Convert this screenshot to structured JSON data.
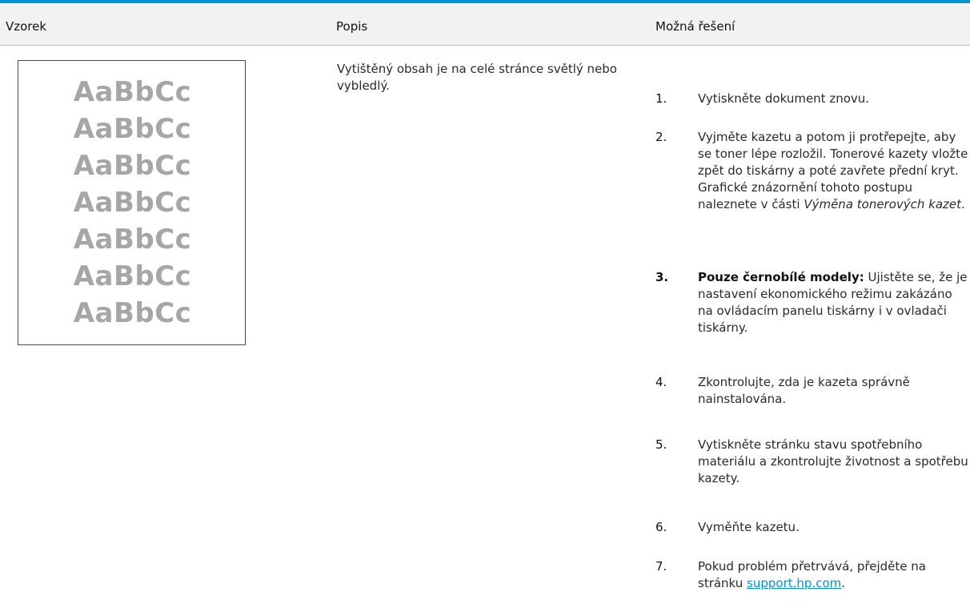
{
  "colors": {
    "top_rule": "#0096d6",
    "header_bg": "#f2f2f2",
    "sample_text": "#a6a6a6",
    "link": "#0096d6"
  },
  "table": {
    "headers": {
      "sample": "Vzorek",
      "description": "Popis",
      "solutions": "Možná řešení"
    }
  },
  "sample": {
    "lines": [
      "AaBbCc",
      "AaBbCc",
      "AaBbCc",
      "AaBbCc",
      "AaBbCc",
      "AaBbCc",
      "AaBbCc"
    ]
  },
  "description": "Vytištěný obsah je na celé stránce světlý nebo vybledlý.",
  "steps": [
    {
      "num": "1.",
      "text": "Vytiskněte dokument znovu."
    },
    {
      "num": "2.",
      "text": "Vyjměte kazetu a potom ji protřepejte, aby se toner lépe rozložil. Tonerové kazety vložte zpět do tiskárny a poté zavřete přední kryt. Grafické znázornění tohoto postupu naleznete v části ",
      "italic": "Výměna tonerových kazet",
      "suffix": "."
    },
    {
      "num": "3.",
      "bold": "Pouze černobílé modely:",
      "text": " Ujistěte se, že je nastavení ekonomického režimu zakázáno na ovládacím panelu tiskárny i v ovladači tiskárny."
    },
    {
      "num": "4.",
      "text": "Zkontrolujte, zda je kazeta správně nainstalována."
    },
    {
      "num": "5.",
      "text": "Vytiskněte stránku stavu spotřebního materiálu a zkontrolujte životnost a spotřebu kazety."
    },
    {
      "num": "6.",
      "text": "Vyměňte kazetu."
    },
    {
      "num": "7.",
      "text": "Pokud problém přetrvává, přejděte na stránku ",
      "link": "support.hp.com",
      "suffix": "."
    }
  ]
}
